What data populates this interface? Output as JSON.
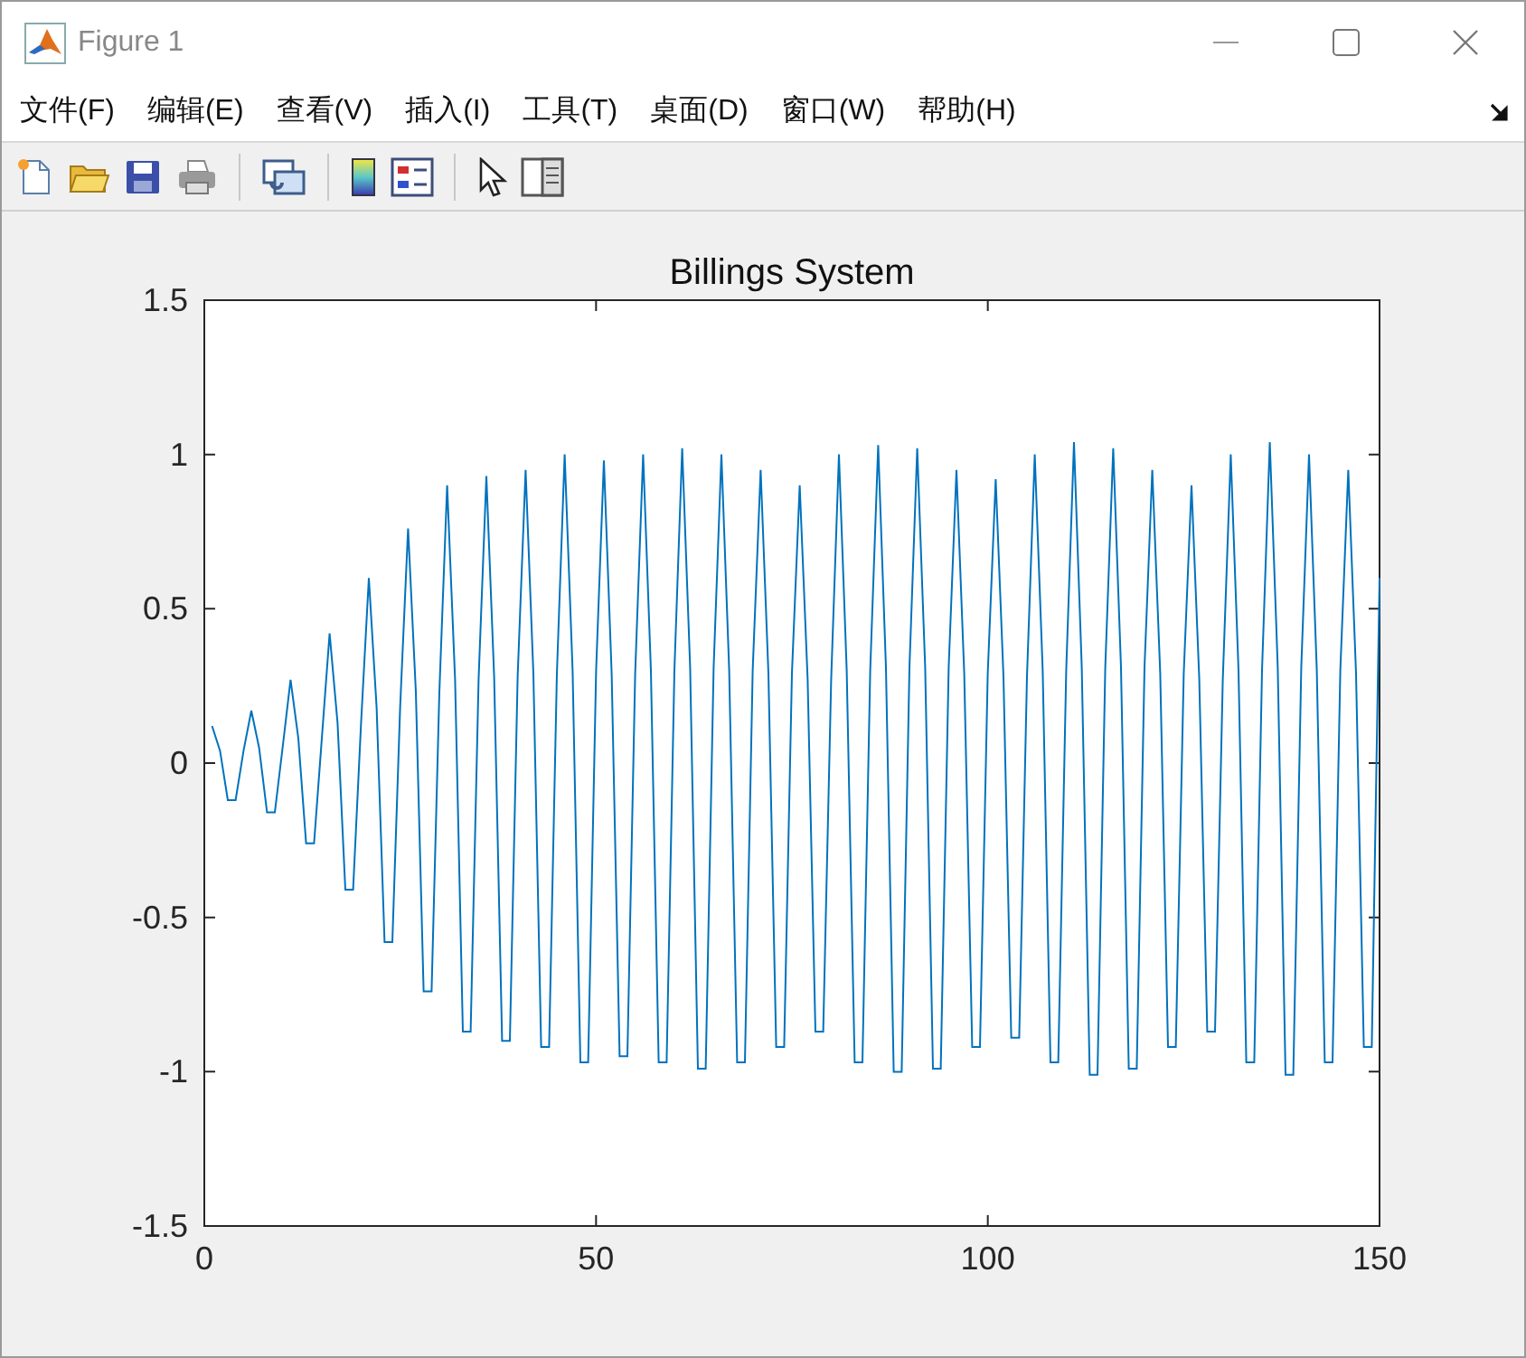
{
  "window": {
    "title": "Figure 1"
  },
  "menu": [
    {
      "label": "文件(F)"
    },
    {
      "label": "编辑(E)"
    },
    {
      "label": "查看(V)"
    },
    {
      "label": "插入(I)"
    },
    {
      "label": "工具(T)"
    },
    {
      "label": "桌面(D)"
    },
    {
      "label": "窗口(W)"
    },
    {
      "label": "帮助(H)"
    }
  ],
  "toolbar": [
    {
      "kind": "new"
    },
    {
      "kind": "open"
    },
    {
      "kind": "save"
    },
    {
      "kind": "print"
    },
    {
      "kind": "sep"
    },
    {
      "kind": "link"
    },
    {
      "kind": "sep"
    },
    {
      "kind": "colorbar"
    },
    {
      "kind": "legend"
    },
    {
      "kind": "sep"
    },
    {
      "kind": "pointer"
    },
    {
      "kind": "inspector"
    }
  ],
  "plot": {
    "chart_data": {
      "type": "line",
      "title": "Billings System",
      "xlim": [
        0,
        150
      ],
      "ylim": [
        -1.5,
        1.5
      ],
      "xticks": [
        0,
        50,
        100,
        150
      ],
      "yticks": [
        -1.5,
        -1,
        -0.5,
        0,
        0.5,
        1,
        1.5
      ],
      "x": [
        1,
        2,
        3,
        4,
        5,
        6,
        7,
        8,
        9,
        10,
        11,
        12,
        13,
        14,
        15,
        16,
        17,
        18,
        19,
        20,
        21,
        22,
        23,
        24,
        25,
        26,
        27,
        28,
        29,
        30,
        31,
        32,
        33,
        34,
        35,
        36,
        37,
        38,
        39,
        40,
        41,
        42,
        43,
        44,
        45,
        46,
        47,
        48,
        49,
        50,
        51,
        52,
        53,
        54,
        55,
        56,
        57,
        58,
        59,
        60,
        61,
        62,
        63,
        64,
        65,
        66,
        67,
        68,
        69,
        70,
        71,
        72,
        73,
        74,
        75,
        76,
        77,
        78,
        79,
        80,
        81,
        82,
        83,
        84,
        85,
        86,
        87,
        88,
        89,
        90,
        91,
        92,
        93,
        94,
        95,
        96,
        97,
        98,
        99,
        100,
        101,
        102,
        103,
        104,
        105,
        106,
        107,
        108,
        109,
        110,
        111,
        112,
        113,
        114,
        115,
        116,
        117,
        118,
        119,
        120,
        121,
        122,
        123,
        124,
        125,
        126,
        127,
        128,
        129,
        130,
        131,
        132,
        133,
        134,
        135,
        136,
        137,
        138,
        139,
        140,
        141,
        142,
        143,
        144,
        145,
        146,
        147,
        148,
        149,
        150
      ],
      "series": [
        {
          "color": "#0072bd",
          "values": [
            0.12,
            0.04,
            -0.12,
            -0.12,
            0.04,
            0.17,
            0.05,
            -0.16,
            -0.16,
            0.05,
            0.27,
            0.08,
            -0.26,
            -0.26,
            0.08,
            0.42,
            0.13,
            -0.41,
            -0.41,
            0.13,
            0.6,
            0.18,
            -0.58,
            -0.58,
            0.18,
            0.76,
            0.23,
            -0.74,
            -0.74,
            0.23,
            0.9,
            0.27,
            -0.87,
            -0.87,
            0.27,
            0.93,
            0.28,
            -0.9,
            -0.9,
            0.28,
            0.95,
            0.29,
            -0.92,
            -0.92,
            0.29,
            1,
            0.3,
            -0.97,
            -0.97,
            0.3,
            0.98,
            0.29,
            -0.95,
            -0.95,
            0.29,
            1,
            0.3,
            -0.97,
            -0.97,
            0.3,
            1.02,
            0.31,
            -0.99,
            -0.99,
            0.31,
            1,
            0.3,
            -0.97,
            -0.97,
            0.3,
            0.95,
            0.29,
            -0.92,
            -0.92,
            0.29,
            0.9,
            0.27,
            -0.87,
            -0.87,
            0.27,
            1,
            0.3,
            -0.97,
            -0.97,
            0.3,
            1.03,
            0.31,
            -1,
            -1,
            0.31,
            1.02,
            0.31,
            -0.99,
            -0.99,
            0.31,
            0.95,
            0.29,
            -0.92,
            -0.92,
            0.29,
            0.92,
            0.28,
            -0.89,
            -0.89,
            0.28,
            1,
            0.3,
            -0.97,
            -0.97,
            0.3,
            1.04,
            0.31,
            -1.01,
            -1.01,
            0.31,
            1.02,
            0.31,
            -0.99,
            -0.99,
            0.31,
            0.95,
            0.29,
            -0.92,
            -0.92,
            0.29,
            0.9,
            0.27,
            -0.87,
            -0.87,
            0.27,
            1,
            0.3,
            -0.97,
            -0.97,
            0.3,
            1.04,
            0.31,
            -1.01,
            -1.01,
            0.31,
            1,
            0.3,
            -0.97,
            -0.97,
            0.3,
            0.95,
            0.29,
            -0.92,
            -0.92,
            0.6
          ]
        }
      ]
    }
  }
}
